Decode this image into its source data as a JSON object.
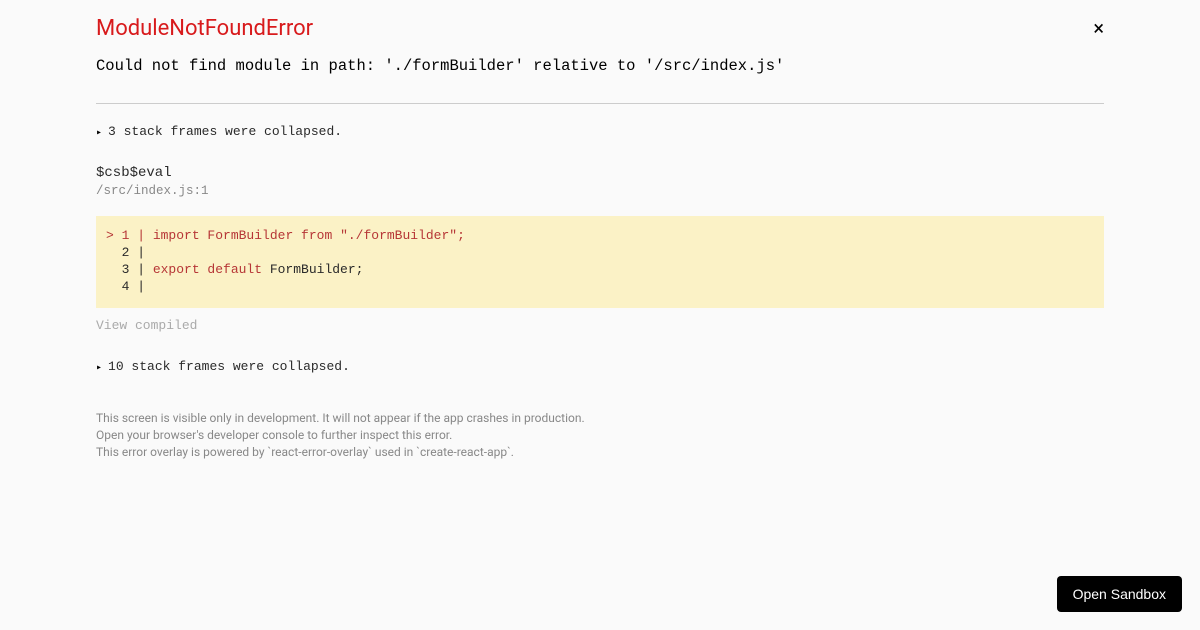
{
  "title": "ModuleNotFoundError",
  "message": "Could not find module in path: './formBuilder' relative to '/src/index.js'",
  "stack1": "3 stack frames were collapsed.",
  "evalName": "$csb$eval",
  "fileLoc": "/src/index.js:1",
  "code": {
    "line1_marker": "> 1 | ",
    "line1_import": "import",
    "line1_name": " FormBuilder ",
    "line1_from": "from",
    "line1_str": " \"./formBuilder\"",
    "line1_semi": ";",
    "line2": "  2 | ",
    "line3_prefix": "  3 | ",
    "line3_export": "export default",
    "line3_rest": " FormBuilder;",
    "line4": "  4 | "
  },
  "viewCompiled": "View compiled",
  "stack2": "10 stack frames were collapsed.",
  "footer": {
    "note1": "This screen is visible only in development. It will not appear if the app crashes in production.",
    "note2": "Open your browser's developer console to further inspect this error.",
    "note3": "This error overlay is powered by `react-error-overlay` used in `create-react-app`."
  },
  "openSandbox": "Open Sandbox"
}
